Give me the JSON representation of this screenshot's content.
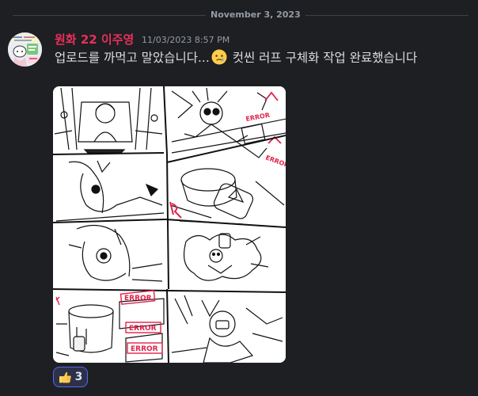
{
  "date_divider": "November 3, 2023",
  "message": {
    "author": "원화 22 이주영",
    "timestamp": "11/03/2023 8:57 PM",
    "text_before_emoji": "업로드를 까먹고 말았습니다...",
    "emoji_icon": "face-holding-back-tears-icon",
    "text_after_emoji": " 컷씬 러프 구체화 작업 완료했습니다",
    "attachment_caption": "ERROR",
    "reaction": {
      "icon": "thumbs-up-icon",
      "count": "3"
    }
  },
  "colors": {
    "background": "#1e1f22",
    "author": "#ea2f5b",
    "reaction_border": "#5865f2"
  }
}
